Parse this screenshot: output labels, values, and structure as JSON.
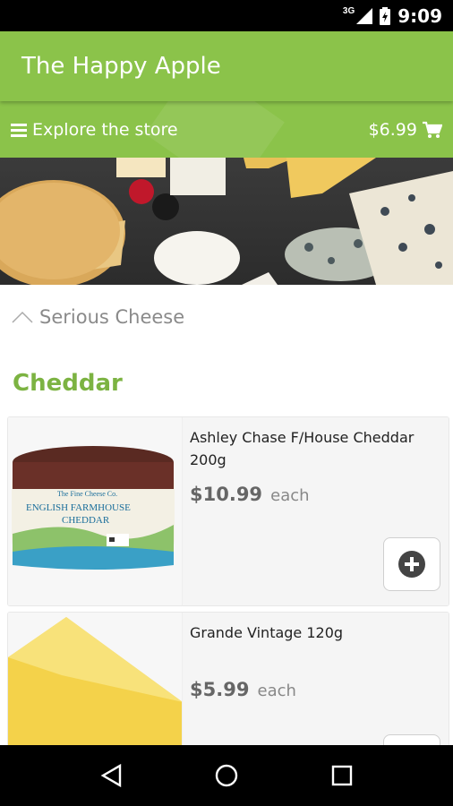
{
  "status_bar": {
    "network": "3G",
    "time": "9:09"
  },
  "app_bar": {
    "title": "The Happy Apple"
  },
  "sub_bar": {
    "menu_icon": "hamburger-icon",
    "explore_label": "Explore the store",
    "cart_total": "$6.99",
    "cart_icon": "cart-icon"
  },
  "section": {
    "label": "Serious Cheese",
    "toggle_icon": "chevron-up-icon"
  },
  "category": {
    "title": "Cheddar"
  },
  "products": [
    {
      "name": "Ashley Chase F/House Cheddar 200g",
      "price": "$10.99",
      "unit": "each",
      "image_label_1": "The Fine Cheese Co.",
      "image_label_2": "ENGLISH FARMHOUSE",
      "image_label_3": "CHEDDAR"
    },
    {
      "name": "Grande Vintage 120g",
      "price": "$5.99",
      "unit": "each"
    }
  ],
  "nav": {
    "back_icon": "back-icon",
    "home_icon": "home-icon",
    "recents_icon": "recents-icon"
  },
  "colors": {
    "brand_green": "#8bc34a",
    "category_green": "#7cb342"
  }
}
